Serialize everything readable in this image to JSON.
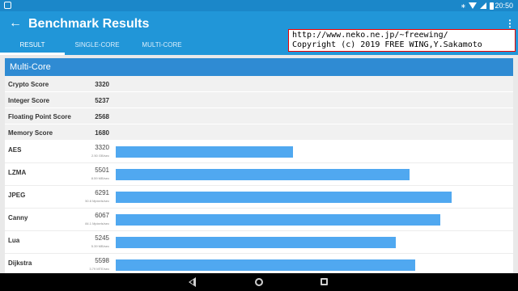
{
  "status_bar": {
    "time": "20:50",
    "icons": [
      "android-debug-icon",
      "bluetooth-icon",
      "wifi-icon",
      "signal-icon",
      "battery-icon"
    ]
  },
  "app_bar": {
    "title": "Benchmark Results",
    "tabs": [
      {
        "label": "RESULT",
        "active": true
      },
      {
        "label": "SINGLE-CORE",
        "active": false
      },
      {
        "label": "MULTI-CORE",
        "active": false
      }
    ]
  },
  "watermark": {
    "line1": "http://www.neko.ne.jp/~freewing/",
    "line2": "Copyright (c) 2019 FREE WING,Y.Sakamoto"
  },
  "section": {
    "title": "Multi-Core",
    "scores": [
      {
        "label": "Crypto Score",
        "value": "3320"
      },
      {
        "label": "Integer Score",
        "value": "5237"
      },
      {
        "label": "Floating Point Score",
        "value": "2568"
      },
      {
        "label": "Memory Score",
        "value": "1680"
      }
    ],
    "bar_max": 7300,
    "benchmarks": [
      {
        "name": "AES",
        "score": 3320,
        "rate": "2.50 GB/sec"
      },
      {
        "name": "LZMA",
        "score": 5501,
        "rate": "8.59 MB/sec"
      },
      {
        "name": "JPEG",
        "score": 6291,
        "rate": "50.6 Mpixels/sec"
      },
      {
        "name": "Canny",
        "score": 6067,
        "rate": "84.1 Mpixels/sec"
      },
      {
        "name": "Lua",
        "score": 5245,
        "rate": "5.39 MB/sec"
      },
      {
        "name": "Dijkstra",
        "score": 5598,
        "rate": "3.79 MTE/sec"
      }
    ]
  },
  "colors": {
    "app_bar": "#2196d8",
    "status_bar": "#1b87c9",
    "bar": "#50a8f0"
  }
}
